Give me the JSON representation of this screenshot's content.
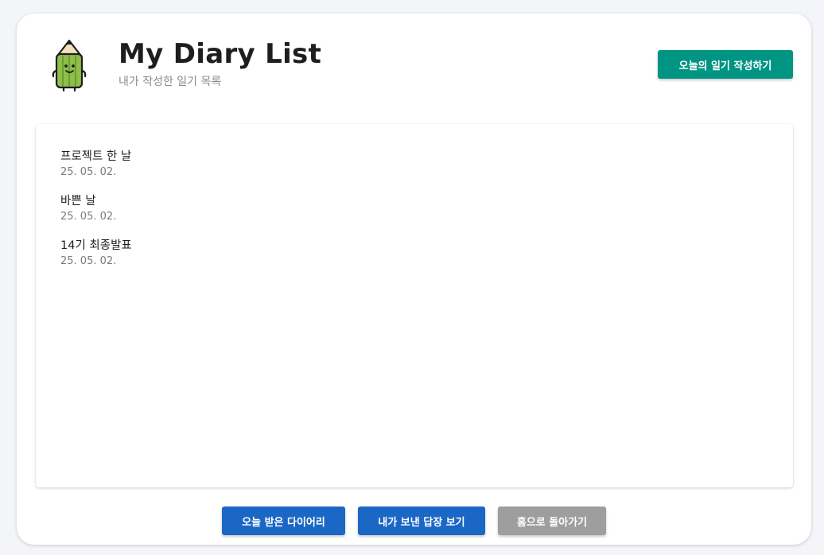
{
  "header": {
    "title": "My Diary List",
    "subtitle": "내가 작성한 일기 목록",
    "write_button_label": "오늘의 일기 작성하기",
    "mascot_icon": "pencil-mascot-icon"
  },
  "diary_list": [
    {
      "title": "프로젝트 한 날",
      "date": "25. 05. 02."
    },
    {
      "title": "바쁜 날",
      "date": "25. 05. 02."
    },
    {
      "title": "14기 최종발표",
      "date": "25. 05. 02."
    }
  ],
  "footer": {
    "received_button_label": "오늘 받은 다이어리",
    "replies_button_label": "내가 보낸 답장 보기",
    "home_button_label": "홈으로 돌아가기"
  },
  "colors": {
    "background": "#f3f5f9",
    "write_button": "#009483",
    "primary_button": "#1b67c6",
    "secondary_button": "#9e9e9e",
    "mascot_green": "#8fbf4a"
  }
}
